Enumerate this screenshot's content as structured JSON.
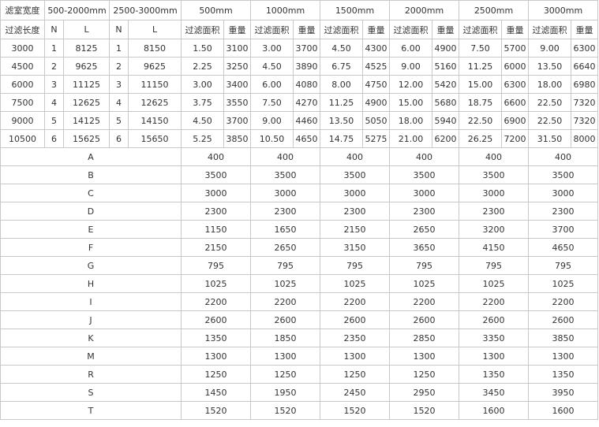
{
  "header_top": {
    "width_label": "滤室宽度",
    "group_a": "500-2000mm",
    "group_b": "2500-3000mm",
    "widths": [
      "500mm",
      "1000mm",
      "1500mm",
      "2000mm",
      "2500mm",
      "3000mm"
    ]
  },
  "header_sub": {
    "length_label": "过滤长度",
    "n_label": "N",
    "l_label": "L",
    "area_label": "过滤面积",
    "weight_label": "重量"
  },
  "data_rows": [
    [
      "3000",
      "1",
      "8125",
      "1",
      "8150",
      "1.50",
      "3100",
      "3.00",
      "3700",
      "4.50",
      "4300",
      "6.00",
      "4900",
      "7.50",
      "5700",
      "9.00",
      "6300"
    ],
    [
      "4500",
      "2",
      "9625",
      "2",
      "9625",
      "2.25",
      "3250",
      "4.50",
      "3890",
      "6.75",
      "4525",
      "9.00",
      "5160",
      "11.25",
      "6000",
      "13.50",
      "6640"
    ],
    [
      "6000",
      "3",
      "11125",
      "3",
      "11150",
      "3.00",
      "3400",
      "6.00",
      "4080",
      "8.00",
      "4750",
      "12.00",
      "5420",
      "15.00",
      "6300",
      "18.00",
      "6980"
    ],
    [
      "7500",
      "4",
      "12625",
      "4",
      "12625",
      "3.75",
      "3550",
      "7.50",
      "4270",
      "11.25",
      "4900",
      "15.00",
      "5680",
      "18.75",
      "6600",
      "22.50",
      "7320"
    ],
    [
      "9000",
      "5",
      "14125",
      "5",
      "14150",
      "4.50",
      "3700",
      "9.00",
      "4460",
      "13.50",
      "5050",
      "18.00",
      "5940",
      "22.50",
      "6900",
      "22.50",
      "7320"
    ],
    [
      "10500",
      "6",
      "15625",
      "6",
      "15650",
      "5.25",
      "3850",
      "10.50",
      "4650",
      "14.75",
      "5275",
      "21.00",
      "6200",
      "26.25",
      "7200",
      "31.50",
      "8000"
    ]
  ],
  "letter_rows": [
    {
      "label": "A",
      "values": [
        "400",
        "400",
        "400",
        "400",
        "400",
        "400"
      ]
    },
    {
      "label": "B",
      "values": [
        "3500",
        "3500",
        "3500",
        "3500",
        "3500",
        "3500"
      ]
    },
    {
      "label": "C",
      "values": [
        "3000",
        "3000",
        "3000",
        "3000",
        "3000",
        "3000"
      ]
    },
    {
      "label": "D",
      "values": [
        "2300",
        "2300",
        "2300",
        "2300",
        "2300",
        "2300"
      ]
    },
    {
      "label": "E",
      "values": [
        "1150",
        "1650",
        "2150",
        "2650",
        "3200",
        "3700"
      ]
    },
    {
      "label": "F",
      "values": [
        "2150",
        "2650",
        "3150",
        "3650",
        "4150",
        "4650"
      ]
    },
    {
      "label": "G",
      "values": [
        "795",
        "795",
        "795",
        "795",
        "795",
        "795"
      ]
    },
    {
      "label": "H",
      "values": [
        "1025",
        "1025",
        "1025",
        "1025",
        "1025",
        "1025"
      ]
    },
    {
      "label": "I",
      "values": [
        "2200",
        "2200",
        "2200",
        "2200",
        "2200",
        "2200"
      ]
    },
    {
      "label": "J",
      "values": [
        "2600",
        "2600",
        "2600",
        "2600",
        "2600",
        "2600"
      ]
    },
    {
      "label": "K",
      "values": [
        "1350",
        "1850",
        "2350",
        "2850",
        "3350",
        "3850"
      ]
    },
    {
      "label": "M",
      "values": [
        "1300",
        "1300",
        "1300",
        "1300",
        "1300",
        "1300"
      ]
    },
    {
      "label": "R",
      "values": [
        "1250",
        "1250",
        "1250",
        "1250",
        "1350",
        "1350"
      ]
    },
    {
      "label": "S",
      "values": [
        "1450",
        "1950",
        "2450",
        "2950",
        "3450",
        "3950"
      ]
    },
    {
      "label": "T",
      "values": [
        "1520",
        "1520",
        "1520",
        "1520",
        "1600",
        "1600"
      ]
    }
  ]
}
